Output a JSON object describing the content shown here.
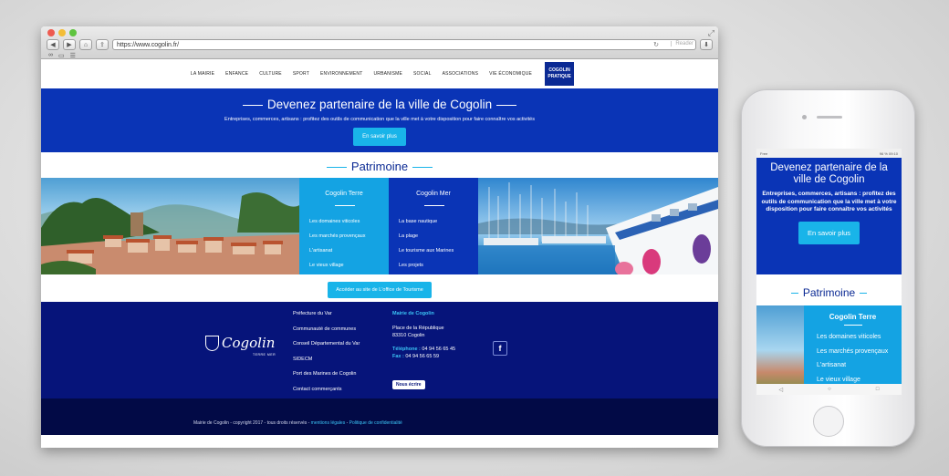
{
  "browser": {
    "url": "https://www.cogolin.fr/",
    "reader_label": "Reader",
    "nav_back": "◀",
    "nav_forward": "▶",
    "home_icon": "⌂",
    "share_icon": "⇪",
    "reload_icon": "↻",
    "resize_icon": "⤢"
  },
  "site": {
    "nav": [
      "LA MAIRIE",
      "ENFANCE",
      "CULTURE",
      "SPORT",
      "ENVIRONNEMENT",
      "URBANISME",
      "SOCIAL",
      "ASSOCIATIONS",
      "VIE ÉCONOMIQUE"
    ],
    "nav_pratique_1": "COGOLIN",
    "nav_pratique_2": "PRATIQUE",
    "hero": {
      "title": "Devenez partenaire de la ville de Cogolin",
      "subtitle": "Entreprises, commerces, artisans : profitez des outils de communication que la ville met à votre disposition pour faire connaître vos activités",
      "button": "En savoir plus"
    },
    "patrimoine": {
      "title": "Patrimoine",
      "terre": {
        "title": "Cogolin Terre",
        "links": [
          "Les domaines viticoles",
          "Les marchés provençaux",
          "L'artisanat",
          "Le vieux village"
        ]
      },
      "mer": {
        "title": "Cogolin Mer",
        "links": [
          "La base nautique",
          "La plage",
          "Le tourisme aux Marines",
          "Les projets"
        ]
      },
      "office_button": "Accéder au site de L'office de Tourisme"
    },
    "footer": {
      "logo_text": "Cogolin",
      "logo_sub": "TERRE MER",
      "links": [
        "Préfecture du Var",
        "Communauté de communes",
        "Conseil Départemental du Var",
        "SIDECM",
        "Port des Marines de Cogolin",
        "Contact commerçants"
      ],
      "contact_title": "Mairie de Cogolin",
      "address_1": "Place de la République",
      "address_2": "83310 Cogolin",
      "tel_label": "Téléphone :",
      "tel": "04 94 56 65 45",
      "fax_label": "Fax :",
      "fax": "04 94 56 65 59",
      "nous_ecrire": "Nous écrire",
      "facebook": "f"
    },
    "bottom": {
      "copyright": "Mairie de Cogolin - copyright 2017 - tous droits réservés - ",
      "mentions": "mentions légales",
      "sep": " - ",
      "politique": "Politique de confidentialité"
    }
  },
  "phone": {
    "status_left": "Free",
    "status_right": "96 % 09:10",
    "hero_title": "Devenez partenaire de la ville de Cogolin",
    "hero_sub": "Entreprises, commerces, artisans : profitez des outils de communication que la ville met à votre disposition pour faire connaître vos activités",
    "hero_button": "En savoir plus",
    "patrimoine": "Patrimoine",
    "terre_title": "Cogolin Terre",
    "terre_links": [
      "Les domaines viticoles",
      "Les marchés provençaux",
      "L'artisanat",
      "Le vieux village"
    ],
    "nav_back": "◁",
    "nav_home": "○",
    "nav_recent": "□"
  }
}
